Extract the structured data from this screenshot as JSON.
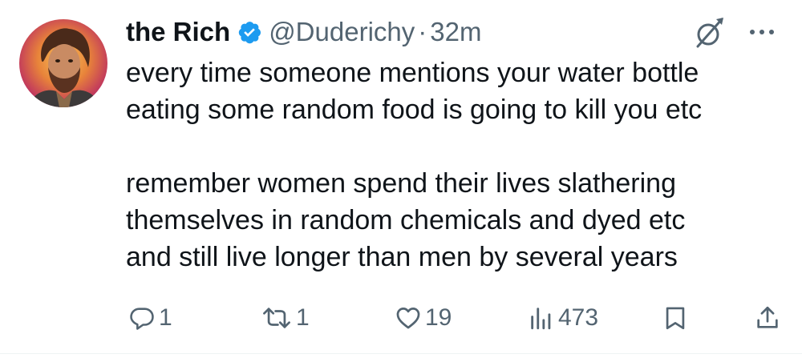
{
  "author": {
    "display_name": "the Rich",
    "handle": "@Duderichy",
    "separator": "·",
    "time": "32m"
  },
  "tweet": {
    "paragraph1": [
      "every time someone mentions your water bottle",
      "eating some random food is going to kill you etc"
    ],
    "paragraph2": [
      "remember women spend their lives slathering",
      "themselves in random chemicals and dyed etc",
      "and still live longer than men by several years"
    ]
  },
  "actions": {
    "replies": "1",
    "reposts": "1",
    "likes": "19",
    "views": "473"
  },
  "colors": {
    "text": "#0f1419",
    "muted": "#536471",
    "verified": "#1d9bf0"
  },
  "icons": {
    "verified": "verified-badge-icon",
    "grok": "grok-icon",
    "more": "more-dots-icon",
    "reply": "reply-icon",
    "repost": "repost-icon",
    "like": "heart-icon",
    "views": "views-icon",
    "bookmark": "bookmark-icon",
    "share": "share-icon"
  }
}
